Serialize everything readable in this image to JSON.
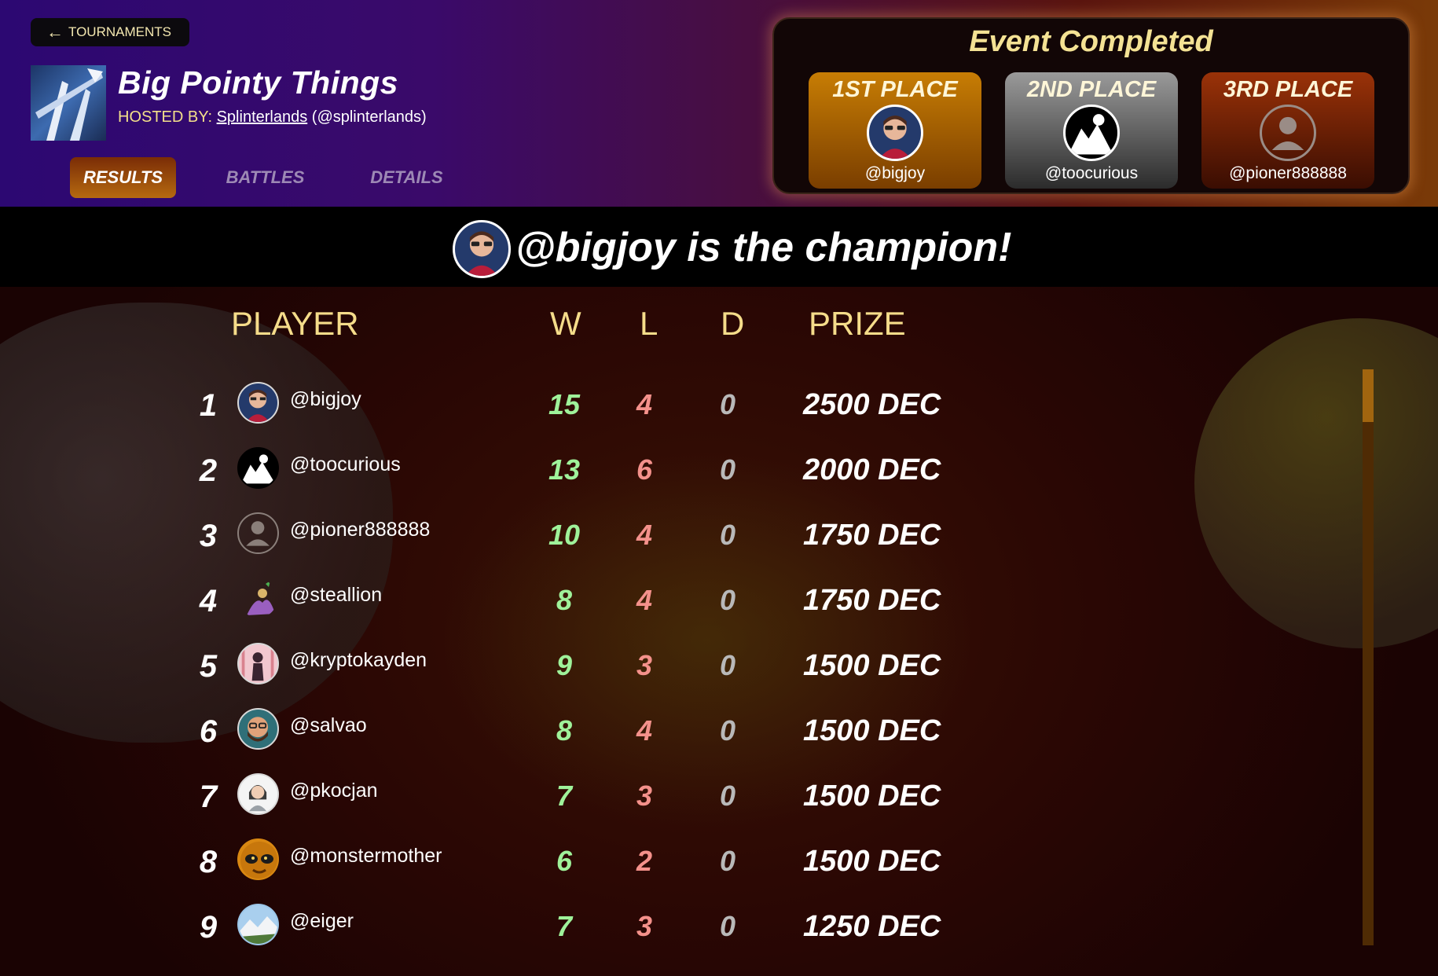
{
  "nav": {
    "back_label": "TOURNAMENTS",
    "back_icon": "arrow-left-icon"
  },
  "tournament": {
    "title": "Big Pointy Things",
    "hosted_by_label": "HOSTED BY:",
    "host_name": "Splinterlands",
    "host_handle": "(@splinterlands)"
  },
  "tabs": [
    {
      "label": "RESULTS",
      "active": true
    },
    {
      "label": "BATTLES",
      "active": false
    },
    {
      "label": "DETAILS",
      "active": false
    }
  ],
  "event": {
    "title": "Event Completed",
    "places": [
      {
        "label": "1ST PLACE",
        "user": "@bigjoy"
      },
      {
        "label": "2ND PLACE",
        "user": "@toocurious"
      },
      {
        "label": "3RD PLACE",
        "user": "@pioner888888"
      }
    ]
  },
  "champion": {
    "text": "@bigjoy is the champion!"
  },
  "table": {
    "headers": {
      "player": "PLAYER",
      "w": "W",
      "l": "L",
      "d": "D",
      "prize": "PRIZE"
    },
    "rows": [
      {
        "rank": "1",
        "user": "@bigjoy",
        "w": "15",
        "l": "4",
        "d": "0",
        "prize": "2500 DEC"
      },
      {
        "rank": "2",
        "user": "@toocurious",
        "w": "13",
        "l": "6",
        "d": "0",
        "prize": "2000 DEC"
      },
      {
        "rank": "3",
        "user": "@pioner888888",
        "w": "10",
        "l": "4",
        "d": "0",
        "prize": "1750 DEC"
      },
      {
        "rank": "4",
        "user": "@steallion",
        "w": "8",
        "l": "4",
        "d": "0",
        "prize": "1750 DEC"
      },
      {
        "rank": "5",
        "user": "@kryptokayden",
        "w": "9",
        "l": "3",
        "d": "0",
        "prize": "1500 DEC"
      },
      {
        "rank": "6",
        "user": "@salvao",
        "w": "8",
        "l": "4",
        "d": "0",
        "prize": "1500 DEC"
      },
      {
        "rank": "7",
        "user": "@pkocjan",
        "w": "7",
        "l": "3",
        "d": "0",
        "prize": "1500 DEC"
      },
      {
        "rank": "8",
        "user": "@monstermother",
        "w": "6",
        "l": "2",
        "d": "0",
        "prize": "1500 DEC"
      },
      {
        "rank": "9",
        "user": "@eiger",
        "w": "7",
        "l": "3",
        "d": "0",
        "prize": "1250 DEC"
      }
    ]
  },
  "colors": {
    "accent_gold": "#f5dc8a",
    "win_green": "#9ff29a",
    "loss_red": "#f4918b",
    "draw_gray": "#b9b9b9"
  }
}
